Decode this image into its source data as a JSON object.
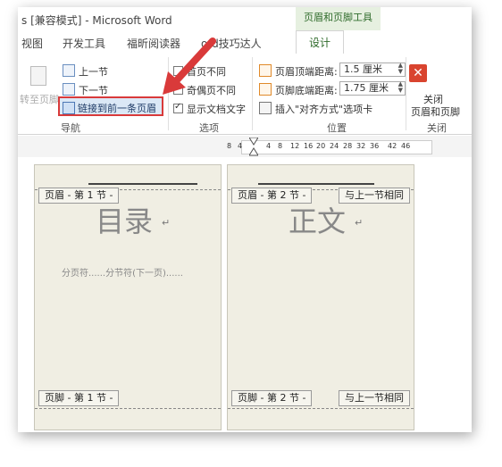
{
  "window": {
    "app_title": "s [兼容模式] - Microsoft Word",
    "context_group_label": "页眉和页脚工具"
  },
  "tabs": [
    {
      "label": "视图"
    },
    {
      "label": "开发工具"
    },
    {
      "label": "福昕阅读器"
    },
    {
      "label": "ord技巧达人"
    },
    {
      "label": "设计",
      "active": true
    }
  ],
  "ribbon": {
    "navigation": {
      "goto_footer_label": "转至页脚",
      "prev_section_label": "上一节",
      "next_section_label": "下一节",
      "link_to_previous_label": "链接到前一条页眉",
      "group_label": "导航"
    },
    "options": {
      "diff_first_page_label": "首页不同",
      "odd_even_label": "奇偶页不同",
      "show_doc_text_label": "显示文档文字",
      "group_label": "选项"
    },
    "position": {
      "header_top_label": "页眉顶端距离:",
      "header_top_value": "1.5 厘米",
      "footer_bottom_label": "页脚底端距离:",
      "footer_bottom_value": "1.75 厘米",
      "insert_align_tab_label": "插入\"对齐方式\"选项卡",
      "group_label": "位置"
    },
    "close": {
      "close_label_line1": "关闭",
      "close_label_line2": "页眉和页脚",
      "group_label": "关闭",
      "icon_color": "#d9442f"
    }
  },
  "ruler": {
    "numbers": [
      "8",
      "4",
      "4",
      "8",
      "12",
      "16",
      "20",
      "24",
      "28",
      "32",
      "36",
      "42",
      "46"
    ]
  },
  "pages": [
    {
      "header_tag": "页眉 - 第 1 节 -",
      "title": "目录",
      "page_break_text": "分页符......分节符(下一页)......",
      "footer_tag": "页脚 - 第 1 节 -"
    },
    {
      "header_tag": "页眉 - 第 2 节 -",
      "same_as_prev_header": "与上一节相同",
      "title": "正文",
      "footer_tag": "页脚 - 第 2 节 -",
      "same_as_prev_footer": "与上一节相同"
    }
  ],
  "colors": {
    "accent_green": "#2f6b2b",
    "highlight_red": "#d93a3a",
    "page_background": "#f0eee3"
  }
}
